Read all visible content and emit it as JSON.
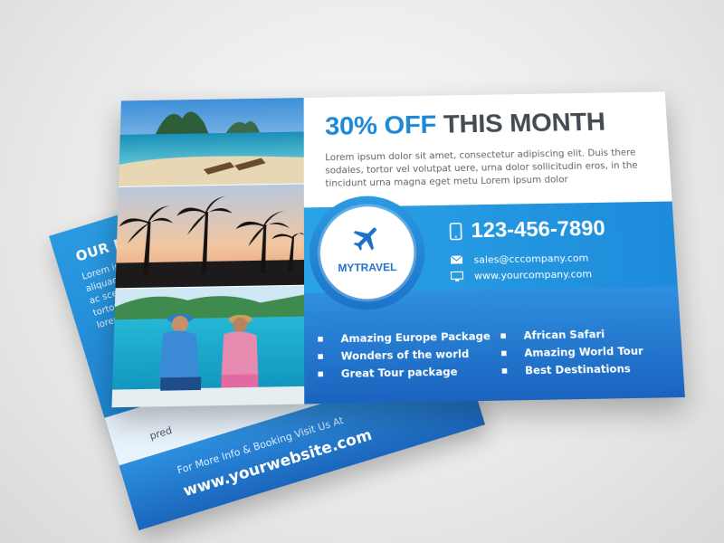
{
  "back_card": {
    "title": "OUR MAIN F",
    "lines": [
      "Lorem ipsum",
      "aliquam ma",
      "ac scelet",
      "tortor v",
      "lorem"
    ],
    "bullet": "pred",
    "info": "For More Info & Booking Visit Us At",
    "website": "www.yourwebsite.com"
  },
  "front_card": {
    "headline_accent": "30% OFF",
    "headline_rest": "THIS MONTH",
    "lorem": "Lorem ipsum dolor sit amet, consectetur adipiscing elit. Duis there sodales, tortor vel volutpat uere, urna dolor sollicitudin eros, in the tincidunt urna magna eget metu Lorem ipsum dolor",
    "logo": "MYTRAVEL",
    "phone": "123-456-7890",
    "email": "sales@cccompany.com",
    "website": "www.yourcompany.com",
    "packages_left": [
      "Amazing Europe Package",
      "Wonders of the world",
      "Great Tour package"
    ],
    "packages_right": [
      "African Safari",
      "Amazing World Tour",
      "Best Destinations"
    ]
  },
  "colors": {
    "accent": "#1e88d8",
    "dark_text": "#444b52",
    "band_blue": "#2aa3e6",
    "deep_blue": "#1a63be"
  },
  "icons": [
    "airplane-icon",
    "phone-icon",
    "mail-icon",
    "monitor-icon"
  ]
}
